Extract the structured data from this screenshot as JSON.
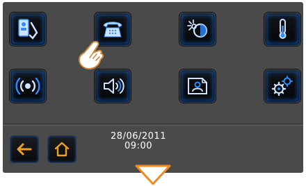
{
  "menu": {
    "items": [
      {
        "icon": "videophone-icon"
      },
      {
        "icon": "telephone-icon"
      },
      {
        "icon": "lights-scenario-icon"
      },
      {
        "icon": "thermometer-icon"
      },
      {
        "icon": "alarm-icon"
      },
      {
        "icon": "speaker-volume-icon"
      },
      {
        "icon": "contact-card-icon"
      },
      {
        "icon": "gears-settings-icon"
      }
    ]
  },
  "footer": {
    "back_icon": "back-arrow-icon",
    "home_icon": "home-icon",
    "date": "28/06/2011",
    "time": "09:00"
  },
  "indicators": {
    "pointer": "pointing-hand-icon",
    "scroll": "down-triangle-icon"
  },
  "colors": {
    "accent_blue": "#2f8cff",
    "accent_orange": "#f0a020",
    "panel": "#4a4a4a"
  }
}
